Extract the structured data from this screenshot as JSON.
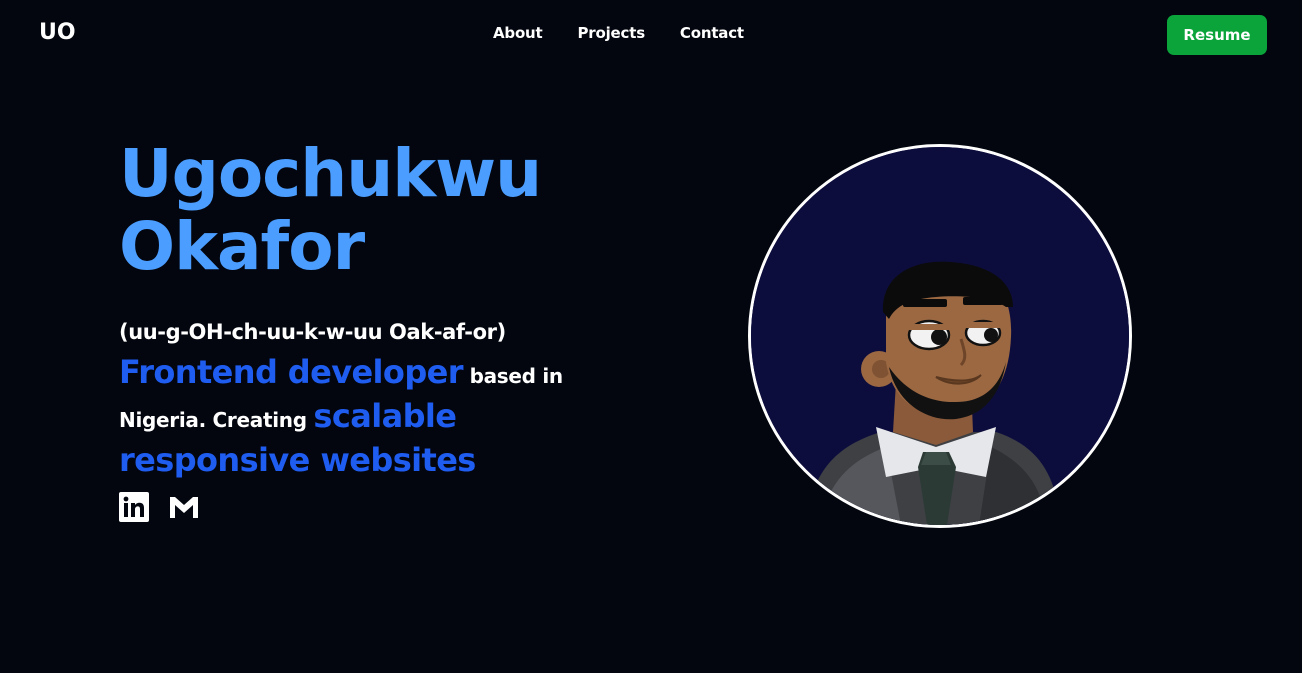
{
  "header": {
    "logo": "UO",
    "nav": [
      {
        "label": "About"
      },
      {
        "label": "Projects"
      },
      {
        "label": "Contact"
      }
    ],
    "resume_label": "Resume"
  },
  "hero": {
    "name_line1": "Ugochukwu",
    "name_line2": "Okafor",
    "pronunciation": "(uu-g-OH-ch-uu-k-w-uu Oak-af-or)",
    "bio": {
      "highlight1": "Frontend developer",
      "text1": " based in Nigeria. Creating ",
      "highlight2": "scalable responsive websites"
    },
    "socials": [
      {
        "icon": "linkedin-icon"
      },
      {
        "icon": "gmail-icon"
      }
    ]
  },
  "colors": {
    "background": "#03060f",
    "name": "#4b9dff",
    "highlight": "#1f5cf0",
    "resume_button": "#0aa43b",
    "avatar_bg": "#0d0d3d"
  }
}
